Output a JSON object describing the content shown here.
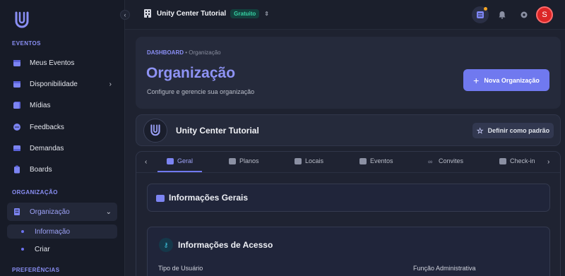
{
  "sidebar": {
    "section_eventos": "EVENTOS",
    "section_organizacao": "ORGANIZAÇÃO",
    "section_preferencias": "PREFERÊNCIAS",
    "items": {
      "meus_eventos": "Meus Eventos",
      "disponibilidade": "Disponibilidade",
      "midias": "Mídias",
      "feedbacks": "Feedbacks",
      "demandas": "Demandas",
      "boards": "Boards",
      "organizacao": "Organização",
      "informacao": "Informação",
      "criar": "Criar"
    },
    "accent": "#8a8ff5"
  },
  "topbar": {
    "org_name": "Unity Center Tutorial",
    "plan_badge": "Gratuito",
    "avatar_initial": "S"
  },
  "header": {
    "breadcrumb_root": "DASHBOARD",
    "breadcrumb_sep": " • ",
    "breadcrumb_current": "Organização",
    "title": "Organização",
    "subtitle": "Configure e gerencie sua organização",
    "new_button": "Nova Organização"
  },
  "org_card": {
    "name": "Unity Center Tutorial",
    "default_button": "Definir como padrão"
  },
  "tabs": {
    "geral": "Geral",
    "planos": "Planos",
    "locais": "Locais",
    "eventos": "Eventos",
    "convites": "Convites",
    "checkin": "Check-in"
  },
  "content": {
    "general_title": "Informações Gerais",
    "access_title": "Informações de Acesso",
    "user_type_label": "Tipo de Usuário",
    "admin_role_label": "Função Administrativa"
  },
  "colors": {
    "primary": "#7079ef",
    "badge_bg": "#13403d",
    "badge_text": "#37d3a4",
    "avatar": "#dc2626"
  }
}
